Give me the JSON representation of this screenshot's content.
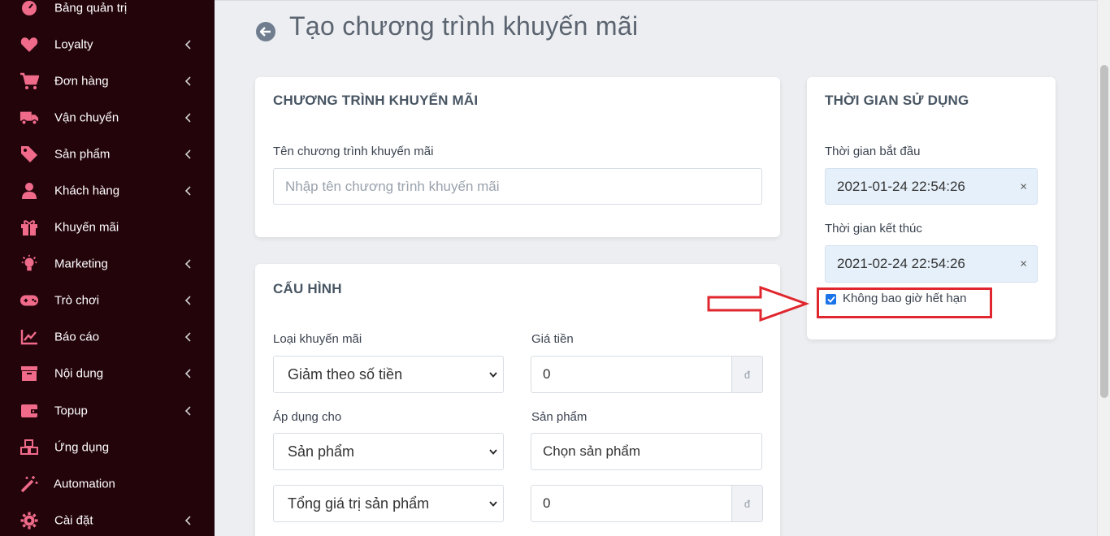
{
  "sidebar": {
    "items": [
      {
        "label": "Bảng quản trị",
        "icon": "dashboard-gauge-icon",
        "has_submenu": false
      },
      {
        "label": "Loyalty",
        "icon": "heart-icon",
        "has_submenu": true
      },
      {
        "label": "Đơn hàng",
        "icon": "shopping-cart-icon",
        "has_submenu": true
      },
      {
        "label": "Vận chuyển",
        "icon": "truck-icon",
        "has_submenu": true
      },
      {
        "label": "Sản phẩm",
        "icon": "tag-icon",
        "has_submenu": true
      },
      {
        "label": "Khách hàng",
        "icon": "user-icon",
        "has_submenu": true
      },
      {
        "label": "Khuyến mãi",
        "icon": "gift-icon",
        "has_submenu": false
      },
      {
        "label": "Marketing",
        "icon": "lightbulb-icon",
        "has_submenu": true
      },
      {
        "label": "Trò chơi",
        "icon": "gamepad-icon",
        "has_submenu": true
      },
      {
        "label": "Báo cáo",
        "icon": "chart-line-icon",
        "has_submenu": true
      },
      {
        "label": "Nội dung",
        "icon": "archive-box-icon",
        "has_submenu": true
      },
      {
        "label": "Topup",
        "icon": "wallet-icon",
        "has_submenu": true
      },
      {
        "label": "Ứng dụng",
        "icon": "cubes-icon",
        "has_submenu": false
      },
      {
        "label": "Automation",
        "icon": "magic-wand-icon",
        "has_submenu": false
      },
      {
        "label": "Cài đặt",
        "icon": "gear-icon",
        "has_submenu": true
      }
    ]
  },
  "page": {
    "title": "Tạo chương trình khuyến mãi"
  },
  "program_card": {
    "title": "CHƯƠNG TRÌNH KHUYẾN MÃI",
    "name_label": "Tên chương trình khuyến mãi",
    "name_placeholder": "Nhập tên chương trình khuyến mãi",
    "name_value": ""
  },
  "config_card": {
    "title": "CẤU HÌNH",
    "promo_type_label": "Loại khuyến mãi",
    "promo_type_value": "Giảm theo số tiền",
    "price_label": "Giá tiền",
    "price_value": "0",
    "currency": "đ",
    "apply_label": "Áp dụng cho",
    "apply_value": "Sản phẩm",
    "product_label": "Sản phẩm",
    "product_value": "Chọn sản phẩm",
    "condition_value": "Tổng giá trị sản phẩm",
    "condition_amount": "0",
    "condition_currency": "đ"
  },
  "time_card": {
    "title": "THỜI GIAN SỬ DỤNG",
    "start_label": "Thời gian bắt đầu",
    "start_value": "2021-01-24 22:54:26",
    "end_label": "Thời gian kết thúc",
    "end_value": "2021-02-24 22:54:26",
    "clear_symbol": "×",
    "never_expire_label": "Không bao giờ hết hạn",
    "never_expire_checked": true
  },
  "colors": {
    "sidebar_bg": "#23040b",
    "accent_pink": "#f06b8a",
    "annotation_red": "#e0262e",
    "checkbox_blue": "#1a73e8"
  }
}
